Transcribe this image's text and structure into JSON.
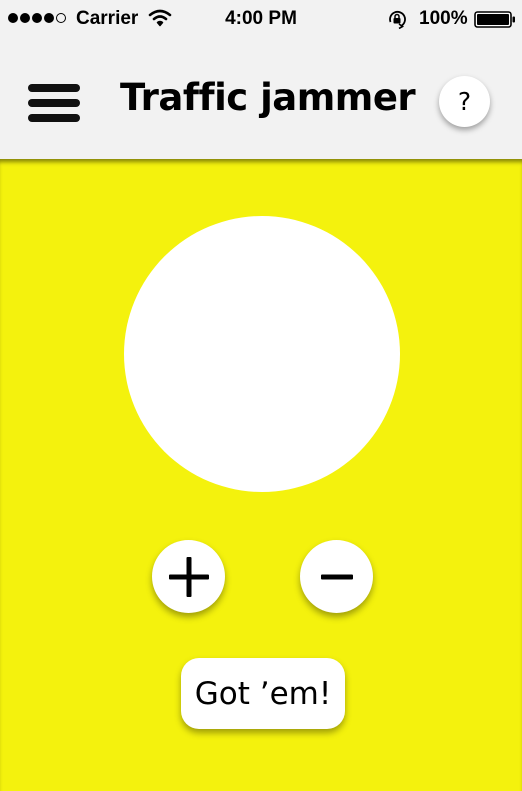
{
  "status_bar": {
    "signal_bars": 4,
    "signal_total": 5,
    "carrier": "Carrier",
    "time": "4:00 PM",
    "battery_percent": "100%",
    "icons": [
      "wifi-icon",
      "orientation-lock-icon",
      "battery-icon"
    ]
  },
  "nav_bar": {
    "title": "Traffic jammer",
    "menu_icon": "hamburger-menu-icon",
    "help_label": "?"
  },
  "main": {
    "background_color": "#f4f20d",
    "indicator_color": "#ffffff",
    "plus_icon": "plus-icon",
    "minus_icon": "minus-icon",
    "got_label": "Got ’em!"
  }
}
